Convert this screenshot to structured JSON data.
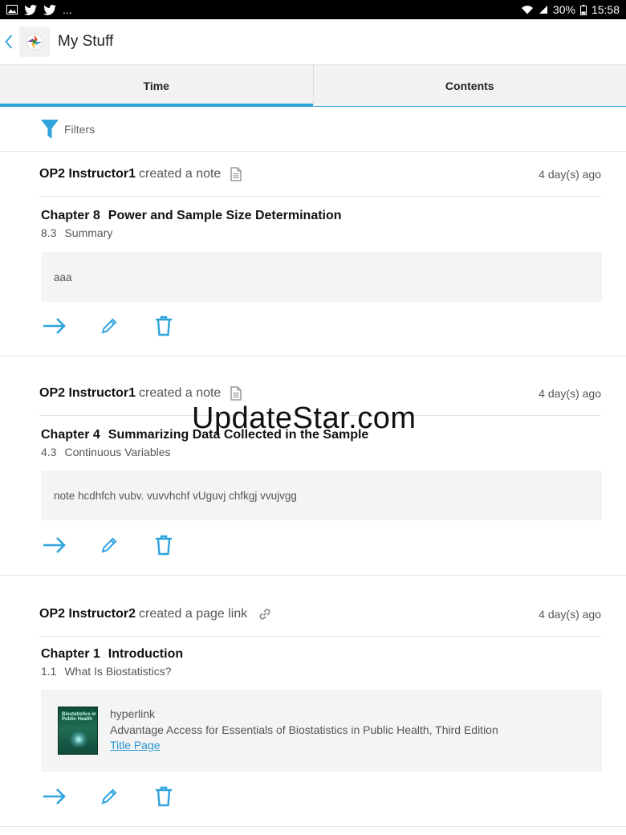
{
  "status_bar": {
    "battery": "30%",
    "clock": "15:58",
    "more": "..."
  },
  "app_bar": {
    "title": "My Stuff"
  },
  "tabs": [
    {
      "label": "Time",
      "active": true
    },
    {
      "label": "Contents",
      "active": false
    }
  ],
  "filters": {
    "label": "Filters"
  },
  "colors": {
    "accent": "#2ea3dc",
    "link": "#2a95d1",
    "note_background": "#f4f4f4"
  },
  "cards": [
    {
      "author": "OP2 Instructor1",
      "action": "created a note",
      "icon": "note-icon",
      "time": "4 day(s) ago",
      "chapter_num": "Chapter 8",
      "chapter_title": "Power and Sample Size Determination",
      "section_num": "8.3",
      "section_title": "Summary",
      "note": "aaa"
    },
    {
      "author": "OP2 Instructor1",
      "action": "created a note",
      "icon": "note-icon",
      "time": "4 day(s) ago",
      "chapter_num": "Chapter 4",
      "chapter_title": "Summarizing Data Collected in the Sample",
      "section_num": "4.3",
      "section_title": "Continuous Variables",
      "note": "note hcdhfch vubv. vuvvhchf vUguvj chfkgj vvujvgg"
    },
    {
      "author": "OP2 Instructor2",
      "action": "created a page link",
      "icon": "link-icon",
      "time": "4 day(s) ago",
      "chapter_num": "Chapter 1",
      "chapter_title": "Introduction",
      "section_num": "1.1",
      "section_title": "What Is Biostatistics?",
      "link_type": "hyperlink",
      "link_description": "Advantage Access for Essentials of Biostatistics in Public Health, Third Edition",
      "link_text": "Title Page"
    }
  ],
  "watermark": "UpdateStar.com"
}
